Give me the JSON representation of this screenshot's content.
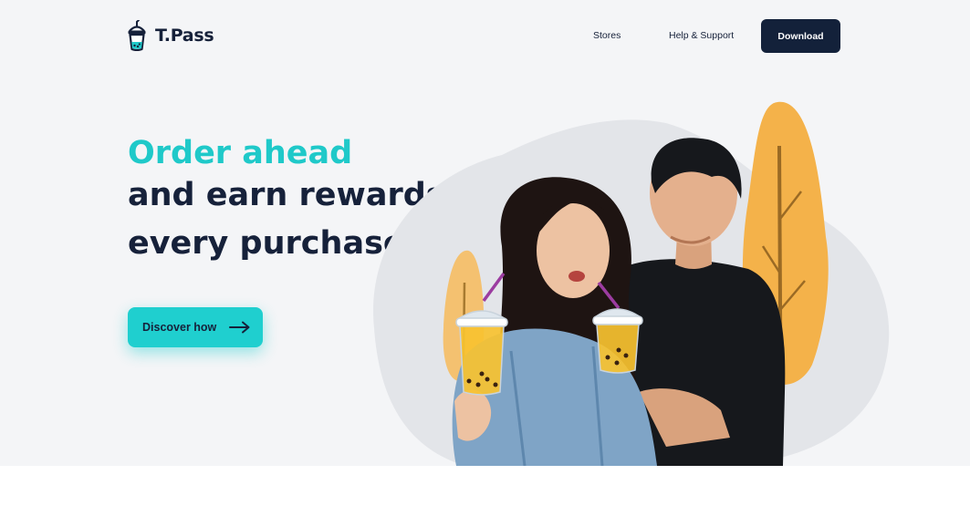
{
  "header": {
    "brand": "T.Pass",
    "nav": [
      {
        "label": "Stores"
      },
      {
        "label": "Help & Support"
      }
    ],
    "download_label": "Download"
  },
  "hero": {
    "headline_accent": "Order ahead",
    "headline_line2": "and earn rewards for",
    "headline_line3": "every purchase",
    "headline_dot": ".",
    "cta_label": "Discover how"
  },
  "colors": {
    "accent": "#1fc9c9",
    "dark": "#16213a",
    "highlight": "#f4b24a",
    "background": "#f4f5f7"
  },
  "icons": {
    "logo": "boba-cup-icon",
    "cta": "arrow-right-icon"
  }
}
